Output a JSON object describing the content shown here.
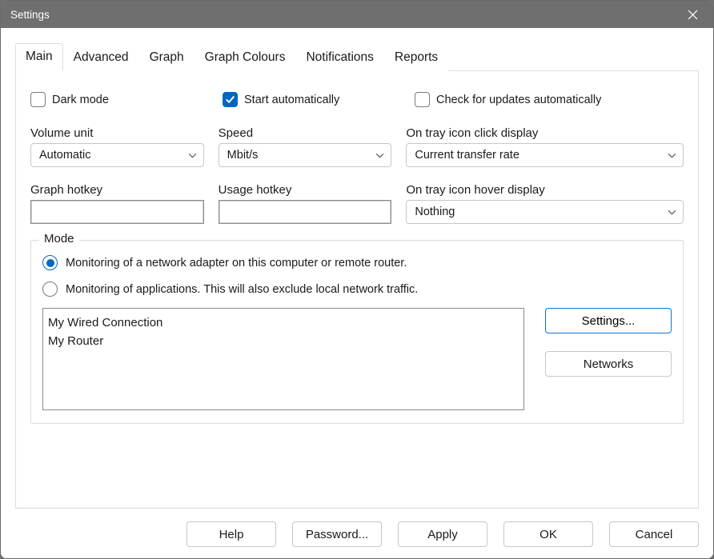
{
  "window": {
    "title": "Settings"
  },
  "tabs": [
    {
      "label": "Main",
      "active": true
    },
    {
      "label": "Advanced",
      "active": false
    },
    {
      "label": "Graph",
      "active": false
    },
    {
      "label": "Graph Colours",
      "active": false
    },
    {
      "label": "Notifications",
      "active": false
    },
    {
      "label": "Reports",
      "active": false
    }
  ],
  "main": {
    "checkboxes": {
      "dark_mode": {
        "label": "Dark mode",
        "checked": false
      },
      "start_auto": {
        "label": "Start automatically",
        "checked": true
      },
      "check_updates": {
        "label": "Check for updates automatically",
        "checked": false
      }
    },
    "fields": {
      "volume_unit": {
        "label": "Volume unit",
        "value": "Automatic"
      },
      "speed": {
        "label": "Speed",
        "value": "Mbit/s"
      },
      "tray_click": {
        "label": "On tray icon click display",
        "value": "Current transfer rate"
      },
      "graph_hotkey": {
        "label": "Graph hotkey",
        "value": ""
      },
      "usage_hotkey": {
        "label": "Usage hotkey",
        "value": ""
      },
      "tray_hover": {
        "label": "On tray icon hover display",
        "value": "Nothing"
      }
    },
    "mode": {
      "title": "Mode",
      "option_adapter": "Monitoring of a network adapter on this computer or remote router.",
      "option_apps": "Monitoring of applications. This will also exclude local network traffic.",
      "selected": "adapter",
      "list": [
        "My Wired Connection",
        "My Router"
      ],
      "buttons": {
        "settings": "Settings...",
        "networks": "Networks"
      }
    }
  },
  "footer": {
    "help": "Help",
    "password": "Password...",
    "apply": "Apply",
    "ok": "OK",
    "cancel": "Cancel"
  }
}
